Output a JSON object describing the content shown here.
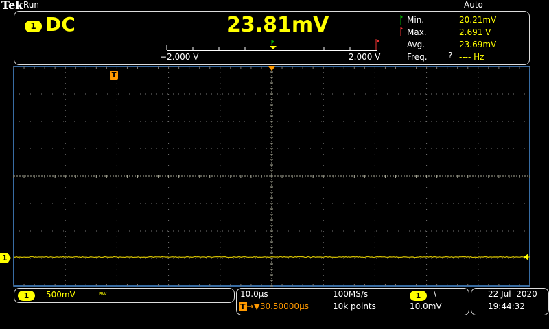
{
  "header": {
    "brand": "Tek",
    "run_state": "Run",
    "trigger_mode": "Auto"
  },
  "meter": {
    "channel": "1",
    "coupling": "DC",
    "value": "23.81mV",
    "scale_min": "−2.000 V",
    "scale_max": "2.000 V",
    "stats": [
      {
        "label": "Min.",
        "value": "20.21mV",
        "flag": "green"
      },
      {
        "label": "Max.",
        "value": "2.691 V",
        "flag": "red"
      },
      {
        "label": "Avg.",
        "value": "23.69mV"
      },
      {
        "label": "Freq.",
        "qualifier": "?",
        "value": "---- Hz"
      }
    ]
  },
  "waveform": {
    "channel": "1",
    "trigger_marker": "T",
    "trace_level_div": -2.95,
    "colors": {
      "trace": "#d4c000",
      "grid": "#777777",
      "border": "#4a90d9",
      "trigger": "#ff9900"
    }
  },
  "channel_bar": {
    "channel": "1",
    "scale": "500mV",
    "bandwidth": "BW"
  },
  "timebase": {
    "scale": "10.0µs",
    "trigger_offset": "30.50000µs",
    "sample_rate": "100MS/s",
    "record_length": "10k points",
    "trigger_channel": "1",
    "trigger_slope": "falling",
    "slope_icon": "\\",
    "trigger_level": "10.0mV"
  },
  "datetime": {
    "date": "22 Jul  2020",
    "time": "19:44:32"
  }
}
